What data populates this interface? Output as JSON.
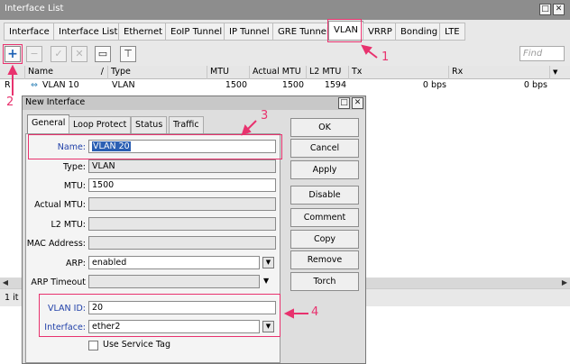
{
  "window": {
    "title": "Interface List",
    "btn_restore": "□",
    "btn_close": "✕"
  },
  "tabs": [
    {
      "label": "Interface"
    },
    {
      "label": "Interface List"
    },
    {
      "label": "Ethernet"
    },
    {
      "label": "EoIP Tunnel"
    },
    {
      "label": "IP Tunnel"
    },
    {
      "label": "GRE Tunnel"
    },
    {
      "label": "VLAN"
    },
    {
      "label": "VRRP"
    },
    {
      "label": "Bonding"
    },
    {
      "label": "LTE"
    }
  ],
  "toolbar": {
    "add": "+",
    "remove": "−",
    "enable": "✓",
    "disable": "✕",
    "comment": "▭",
    "filter": "⊤",
    "find_placeholder": "Find"
  },
  "table": {
    "columns": [
      "Name",
      "Type",
      "MTU",
      "Actual MTU",
      "L2 MTU",
      "Tx",
      "Rx"
    ],
    "sort_indicator": "/",
    "row": {
      "flag": "R",
      "icon": "vlan-icon",
      "name": "VLAN 10",
      "type": "VLAN",
      "mtu": "1500",
      "actual_mtu": "1500",
      "l2_mtu": "1594",
      "tx": "0 bps",
      "rx": "0 bps"
    }
  },
  "status": {
    "items": "1 it"
  },
  "dialog": {
    "title": "New Interface",
    "tabs": [
      "General",
      "Loop Protect",
      "Status",
      "Traffic"
    ],
    "fields": {
      "name_label": "Name:",
      "name_value": "VLAN 20",
      "type_label": "Type:",
      "type_value": "VLAN",
      "mtu_label": "MTU:",
      "mtu_value": "1500",
      "actual_mtu_label": "Actual MTU:",
      "actual_mtu_value": "",
      "l2mtu_label": "L2 MTU:",
      "l2mtu_value": "",
      "mac_label": "MAC Address:",
      "mac_value": "",
      "arp_label": "ARP:",
      "arp_value": "enabled",
      "arp_timeout_label": "ARP Timeout",
      "arp_timeout_value": "",
      "vlan_id_label": "VLAN ID:",
      "vlan_id_value": "20",
      "interface_label": "Interface:",
      "interface_value": "ether2",
      "service_tag_label": "Use Service Tag"
    },
    "buttons": [
      "OK",
      "Cancel",
      "Apply",
      "Disable",
      "Comment",
      "Copy",
      "Remove",
      "Torch"
    ]
  },
  "annotations": {
    "step1": "1",
    "step2": "2",
    "step3": "3",
    "step4": "4"
  },
  "colors": {
    "annotation": "#e8326e",
    "add_button": "#1a5fb4",
    "label_blue": "#1f3fa8"
  }
}
